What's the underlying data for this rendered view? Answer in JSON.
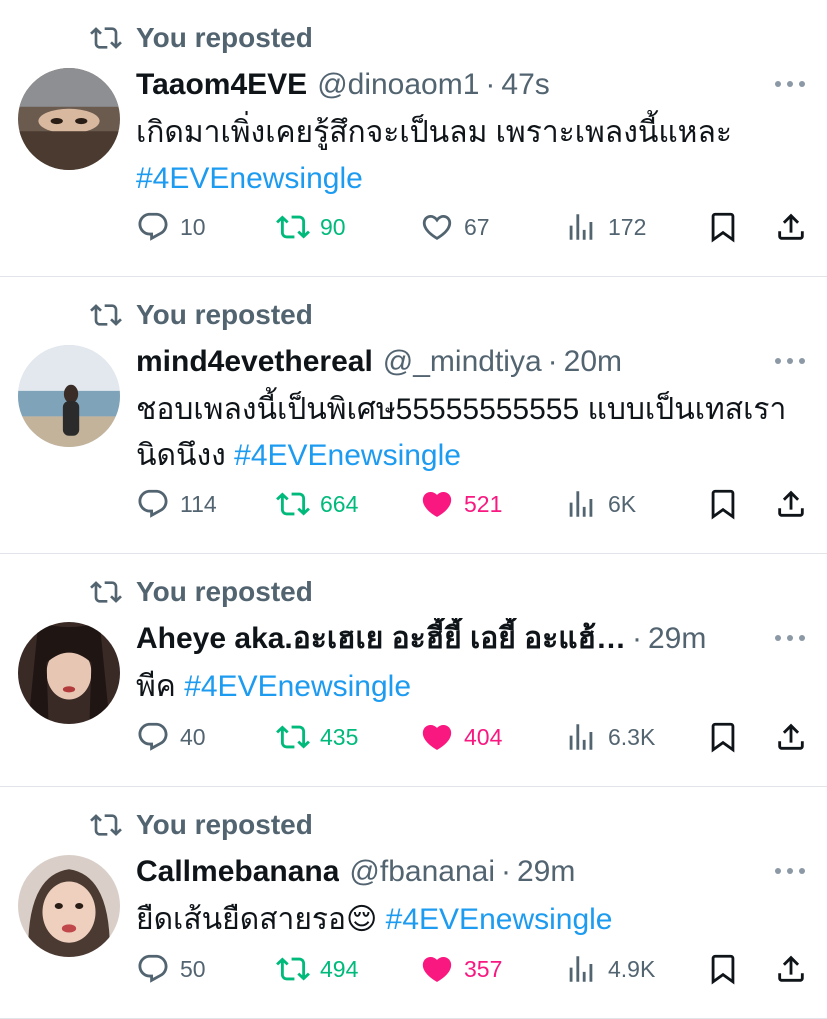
{
  "tweets": [
    {
      "repost_label": "You reposted",
      "name": "Taaom4EVE",
      "handle": "@dinoaom1",
      "time": "47s",
      "text": "เกิดมาเพิ่งเคยรู้สึกจะเป็นลม เพราะเพลงนี้แหละ ",
      "hashtag": "#4EVEnewsingle",
      "replies": "10",
      "reposts": "90",
      "likes": "67",
      "views": "172",
      "liked": false
    },
    {
      "repost_label": "You reposted",
      "name": "mind4evethereal",
      "handle": "@_mindtiya",
      "time": "20m",
      "text": "ชอบเพลงนี้เป็นพิเศษ55555555555 แบบเป็นเทสเรานิดนึงง ",
      "hashtag": "#4EVEnewsingle",
      "replies": "114",
      "reposts": "664",
      "likes": "521",
      "views": "6K",
      "liked": true
    },
    {
      "repost_label": "You reposted",
      "name": "Aheye aka.อะเฮเย อะฮี้ยี้ เอยี้ อะแฮ้…",
      "handle": "",
      "time": "29m",
      "text": "พีค ",
      "hashtag": "#4EVEnewsingle",
      "replies": "40",
      "reposts": "435",
      "likes": "404",
      "views": "6.3K",
      "liked": true
    },
    {
      "repost_label": "You reposted",
      "name": "Callmebanana",
      "handle": "@fbananai",
      "time": "29m",
      "text": "ยืดเส้นยืดสายรอ😌 ",
      "hashtag": "#4EVEnewsingle",
      "replies": "50",
      "reposts": "494",
      "likes": "357",
      "views": "4.9K",
      "liked": true
    }
  ],
  "colors": {
    "text": "#0f1419",
    "muted": "#536471",
    "link": "#1d9bf0",
    "repost_green": "#00ba7c",
    "like_pink": "#f91880",
    "divider": "#e1e4e8"
  },
  "icons": [
    "repost-icon",
    "reply-icon",
    "like-icon",
    "views-icon",
    "bookmark-icon",
    "share-icon",
    "more-icon"
  ]
}
